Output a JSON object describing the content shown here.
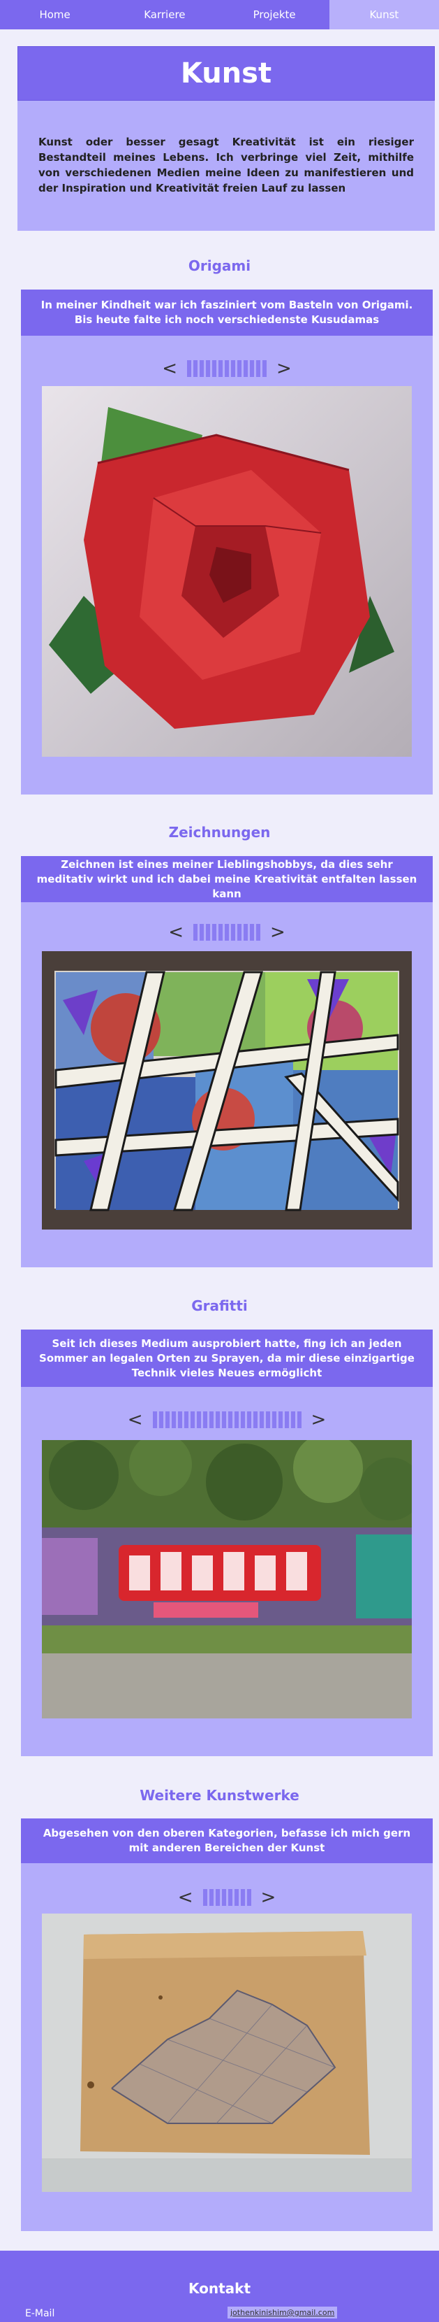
{
  "nav": {
    "items": [
      {
        "label": "Home"
      },
      {
        "label": "Karriere"
      },
      {
        "label": "Projekte"
      },
      {
        "label": "Kunst"
      }
    ],
    "active": "Kunst"
  },
  "hero": {
    "title": "Kunst",
    "text": "Kunst oder besser gesagt Kreativität ist ein riesiger Bestandteil meines Lebens. Ich verbringe viel Zeit, mithilfe von verschiedenen Medien meine Ideen zu manifestieren und der Inspiration und Kreativität freien Lauf zu lassen"
  },
  "sections": [
    {
      "title": "Origami",
      "description": "In meiner Kindheit war ich fasziniert vom Basteln von Origami. Bis heute falte ich noch verschiedenste Kusudamas",
      "prev": "<",
      "next": ">"
    },
    {
      "title": "Zeichnungen",
      "description": "Zeichnen ist eines meiner Lieblingshobbys, da dies sehr meditativ wirkt und ich dabei meine Kreativität entfalten lassen kann",
      "prev": "<",
      "next": ">"
    },
    {
      "title": "Grafitti",
      "description": "Seit ich dieses Medium ausprobiert hatte, fing ich an jeden Sommer an legalen Orten zu Sprayen, da mir diese einzigartige Technik vieles Neues ermöglicht",
      "prev": "<",
      "next": ">"
    },
    {
      "title": "Weitere Kunstwerke",
      "description": "Abgesehen von den oberen Kategorien, befasse ich mich gern mit anderen Bereichen der Kunst",
      "prev": "<",
      "next": ">"
    }
  ],
  "footer": {
    "title": "Kontakt",
    "email_label": "E-Mail",
    "email": "jothenkinishim@gmail.com"
  }
}
